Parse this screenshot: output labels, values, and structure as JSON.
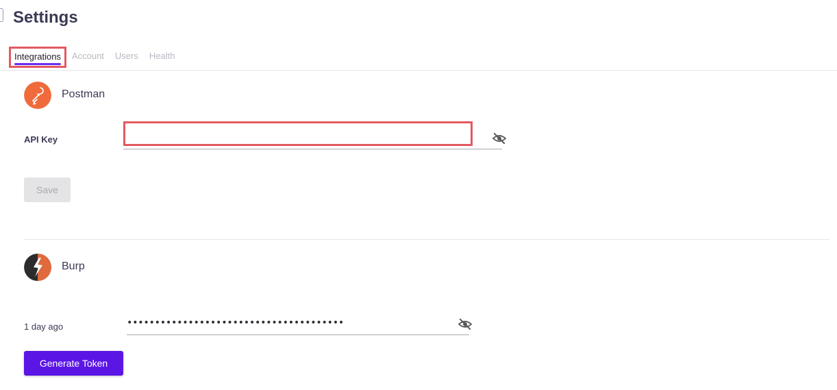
{
  "page": {
    "title": "Settings"
  },
  "tabs": [
    {
      "label": "Integrations",
      "active": true
    },
    {
      "label": "Account",
      "active": false
    },
    {
      "label": "Users",
      "active": false
    },
    {
      "label": "Health",
      "active": false
    }
  ],
  "postman": {
    "name": "Postman",
    "api_key_label": "API Key",
    "api_key_value": "",
    "save_label": "Save",
    "logo_icon": "postman-logo-icon",
    "visibility_icon": "eye-off-icon"
  },
  "burp": {
    "name": "Burp",
    "timestamp": "1 day ago",
    "token_value": "•••••••••••••••••••••••••••••••••••••••",
    "generate_label": "Generate Token",
    "logo_icon": "burp-logo-icon",
    "visibility_icon": "eye-off-icon"
  },
  "colors": {
    "accent": "#5b16e6",
    "tab_underline": "#6a2cf0",
    "highlight_border": "#e25a60",
    "postman_orange": "#ef6b3b",
    "burp_dark": "#2c2c2c"
  }
}
